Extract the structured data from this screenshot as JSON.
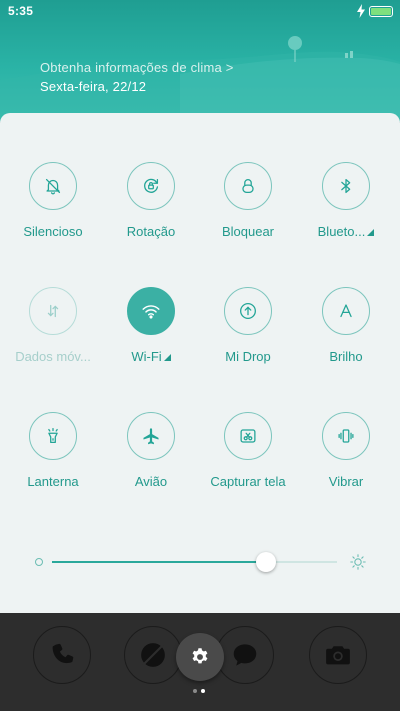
{
  "status_bar": {
    "time": "5:35",
    "battery_icon": "battery-charging-icon"
  },
  "header": {
    "weather_link": "Obtenha informações de clima >",
    "date": "Sexta-feira, 22/12"
  },
  "toggles": [
    {
      "label": "Silencioso",
      "icon": "bell-off-icon",
      "state": "off"
    },
    {
      "label": "Rotação",
      "icon": "rotation-lock-icon",
      "state": "off"
    },
    {
      "label": "Bloquear",
      "icon": "lock-icon",
      "state": "off"
    },
    {
      "label": "Blueto...",
      "icon": "bluetooth-icon",
      "state": "off",
      "has_more": true
    },
    {
      "label": "Dados móv...",
      "icon": "mobile-data-icon",
      "state": "disabled"
    },
    {
      "label": "Wi-Fi",
      "icon": "wifi-icon",
      "state": "on",
      "has_more": true
    },
    {
      "label": "Mi Drop",
      "icon": "mi-drop-icon",
      "state": "off"
    },
    {
      "label": "Brilho",
      "icon": "brightness-auto-icon",
      "state": "off"
    },
    {
      "label": "Lanterna",
      "icon": "flashlight-icon",
      "state": "off"
    },
    {
      "label": "Avião",
      "icon": "airplane-icon",
      "state": "off"
    },
    {
      "label": "Capturar tela",
      "icon": "screenshot-icon",
      "state": "off"
    },
    {
      "label": "Vibrar",
      "icon": "vibrate-icon",
      "state": "off"
    }
  ],
  "brightness": {
    "level": 0.75
  },
  "dock": [
    "phone-icon",
    "browser-icon",
    "messages-icon",
    "camera-icon"
  ],
  "settings_button": "settings-gear-icon",
  "page_indicator": {
    "pages": 2,
    "current": 2
  },
  "colors": {
    "accent": "#2aa89b",
    "header_top": "#1f9e92",
    "panel_bg": "#eef3f3",
    "dock_bg": "#2d2d2d"
  }
}
